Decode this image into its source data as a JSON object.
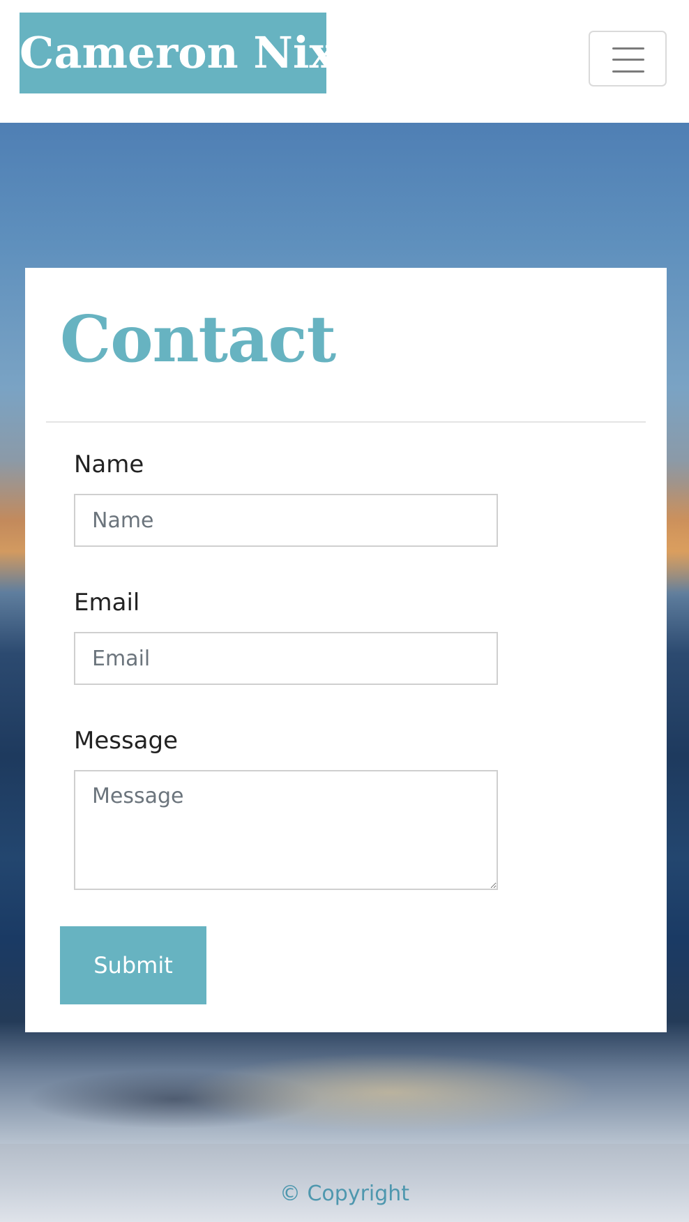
{
  "navbar": {
    "brand": "Cameron Nix",
    "toggler_icon": "hamburger-icon"
  },
  "contact": {
    "title": "Contact",
    "name_label": "Name",
    "name_placeholder": "Name",
    "email_label": "Email",
    "email_placeholder": "Email",
    "message_label": "Message",
    "message_placeholder": "Message",
    "submit_label": "Submit"
  },
  "footer": {
    "copyright": "© Copyright"
  },
  "colors": {
    "accent": "#67b3c1",
    "footer_text": "#4e97ae"
  }
}
